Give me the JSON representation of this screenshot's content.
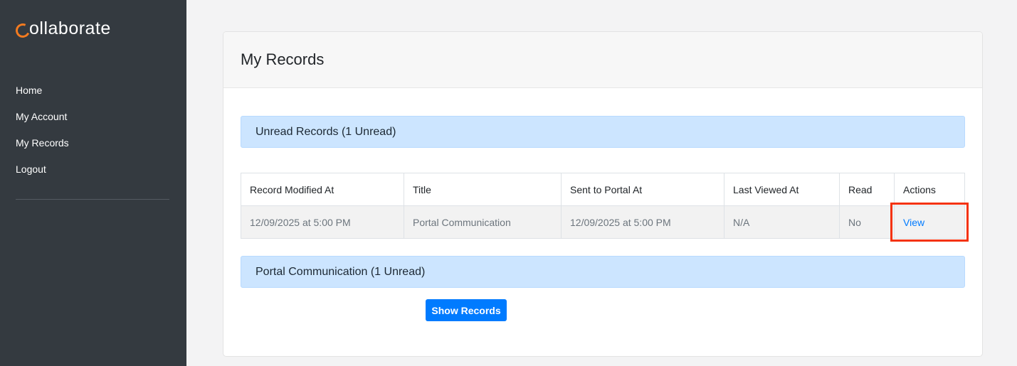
{
  "brand": {
    "name": "ollaborate",
    "accent_color": "#f47b20"
  },
  "sidebar": {
    "items": [
      {
        "label": "Home"
      },
      {
        "label": "My Account"
      },
      {
        "label": "My Records"
      },
      {
        "label": "Logout"
      }
    ]
  },
  "main": {
    "title": "My Records",
    "unread_section": {
      "label": "Unread Records (1 Unread)"
    },
    "table": {
      "headers": [
        "Record Modified At",
        "Title",
        "Sent to Portal At",
        "Last Viewed At",
        "Read",
        "Actions"
      ],
      "rows": [
        {
          "modified_at": "12/09/2025 at 5:00 PM",
          "title": "Portal Communication",
          "sent_at": "12/09/2025 at 5:00 PM",
          "last_viewed": "N/A",
          "read": "No",
          "action": "View"
        }
      ]
    },
    "category_section": {
      "label": "Portal Communication (1 Unread)"
    },
    "show_records_label": "Show Records"
  },
  "colors": {
    "sidebar_bg": "#343a40",
    "primary": "#007bff",
    "section_bg": "#cce5ff",
    "highlight": "#f4320c"
  }
}
